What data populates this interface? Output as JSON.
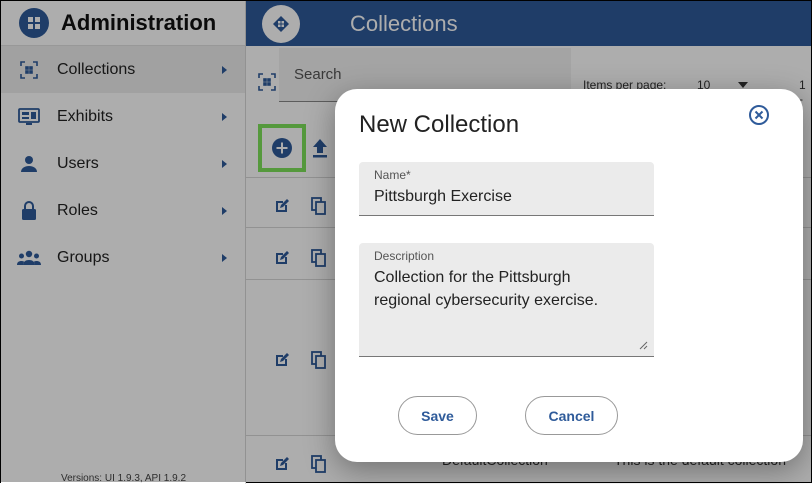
{
  "sidebar": {
    "title": "Administration",
    "items": [
      {
        "label": "Collections",
        "icon": "collections-icon"
      },
      {
        "label": "Exhibits",
        "icon": "exhibits-icon"
      },
      {
        "label": "Users",
        "icon": "user-icon"
      },
      {
        "label": "Roles",
        "icon": "lock-icon"
      },
      {
        "label": "Groups",
        "icon": "groups-icon"
      }
    ],
    "version": "Versions: UI 1.9.3, API 1.9.2"
  },
  "header": {
    "title": "Collections"
  },
  "main": {
    "search_placeholder": "Search",
    "items_per_page_label": "Items per page:",
    "items_per_page_value": "10",
    "range_text": "1 -",
    "bottom_row_name": "DefaultCollection",
    "bottom_row_description": "This is the default collection"
  },
  "dialog": {
    "title": "New Collection",
    "name_label": "Name*",
    "name_value": "Pittsburgh Exercise",
    "description_label": "Description",
    "description_line1": "Collection for the Pittsburgh",
    "description_line2": "regional cybersecurity exercise.",
    "save_label": "Save",
    "cancel_label": "Cancel"
  },
  "colors": {
    "brand": "#2f5b9a",
    "highlight": "#7ee25b"
  }
}
